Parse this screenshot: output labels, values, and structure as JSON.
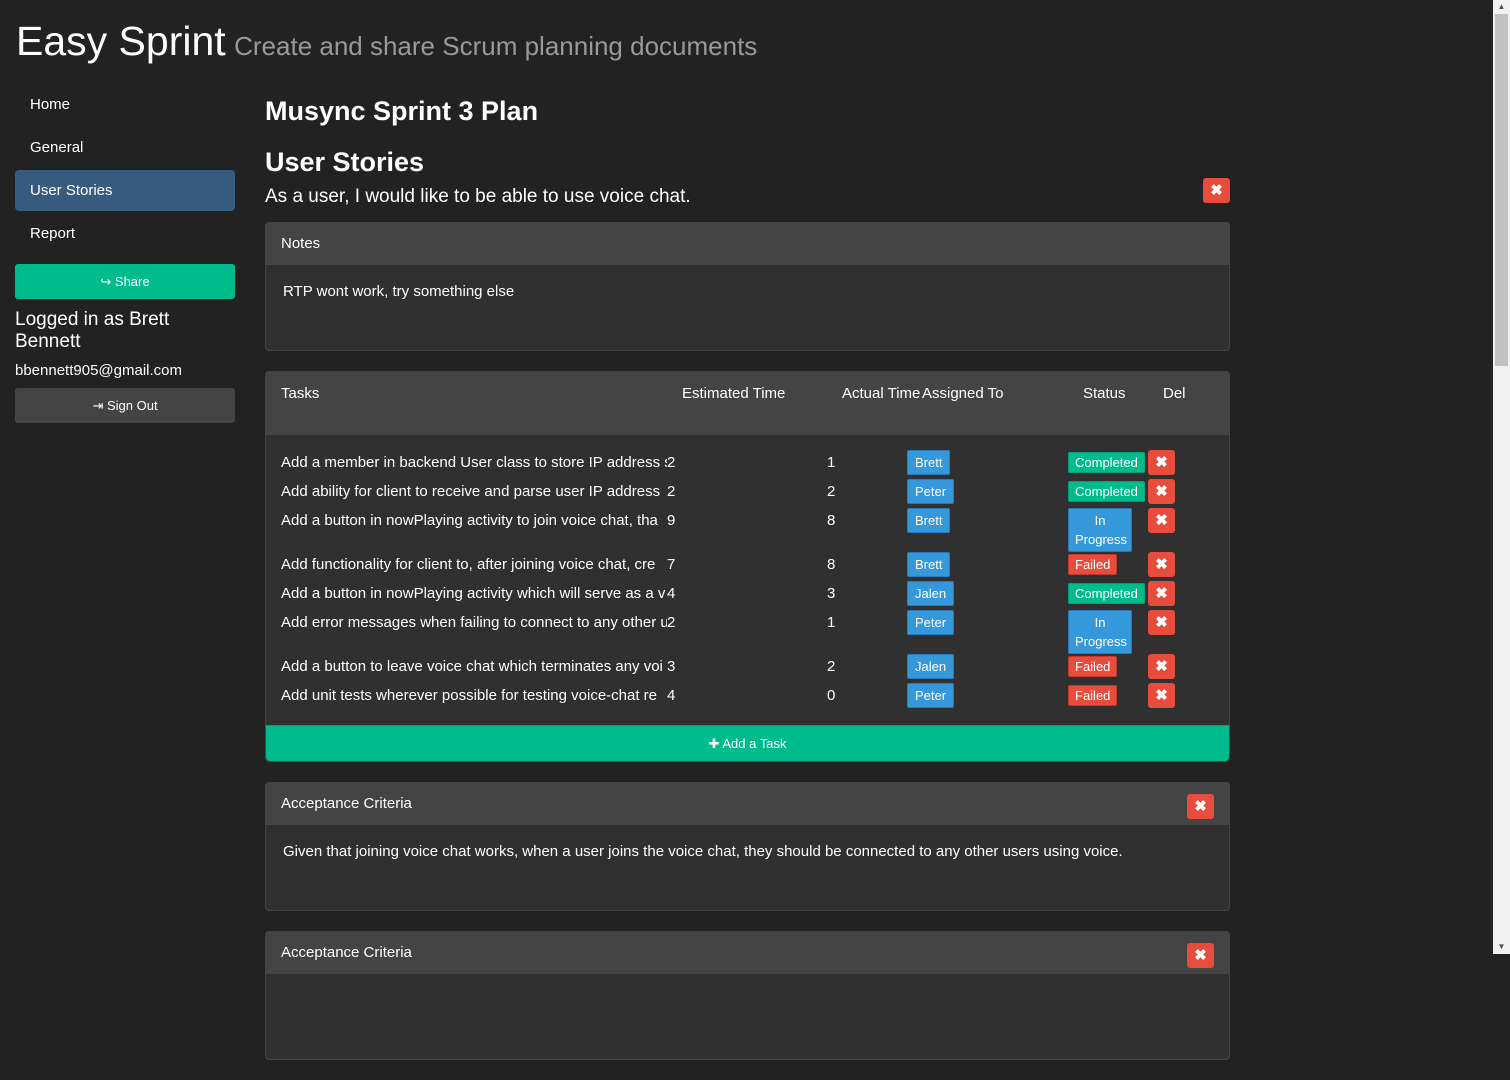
{
  "header": {
    "title": "Easy Sprint",
    "subtitle": "Create and share Scrum planning documents"
  },
  "sidebar": {
    "items": [
      {
        "label": "Home"
      },
      {
        "label": "General"
      },
      {
        "label": "User Stories"
      },
      {
        "label": "Report"
      }
    ],
    "active_item": "User Stories",
    "share_label": "Share",
    "logged_in_text": "Logged in as Brett Bennett",
    "email": "bbennett905@gmail.com",
    "signout_label": "Sign Out"
  },
  "main": {
    "page_title": "Musync Sprint 3 Plan",
    "section_title": "User Stories",
    "story": {
      "text": "As a user, I would like to be able to use voice chat.",
      "delete_label": "✖"
    },
    "notes": {
      "heading": "Notes",
      "body": "RTP wont work, try something else"
    },
    "tasks": {
      "headers": {
        "name": "Tasks",
        "estimated": "Estimated Time",
        "actual": "Actual Time",
        "assigned": "Assigned To",
        "status": "Status",
        "del": "Del"
      },
      "rows": [
        {
          "name": "Add a member in backend User class to store IP address s",
          "estimated": "2",
          "actual": "1",
          "assigned": "Brett",
          "status": "Completed"
        },
        {
          "name": "Add ability for client to receive and parse user IP address",
          "estimated": "2",
          "actual": "2",
          "assigned": "Peter",
          "status": "Completed"
        },
        {
          "name": "Add a button in nowPlaying activity to join voice chat, tha",
          "estimated": "9",
          "actual": "8",
          "assigned": "Brett",
          "status": "In Progress"
        },
        {
          "name": "Add functionality for client to, after joining voice chat, cre",
          "estimated": "7",
          "actual": "8",
          "assigned": "Brett",
          "status": "Failed"
        },
        {
          "name": "Add a button in nowPlaying activity which will serve as a v",
          "estimated": "4",
          "actual": "3",
          "assigned": "Jalen",
          "status": "Completed"
        },
        {
          "name": "Add error messages when failing to connect to any other u",
          "estimated": "2",
          "actual": "1",
          "assigned": "Peter",
          "status": "In Progress"
        },
        {
          "name": "Add a button to leave voice chat which terminates any voi",
          "estimated": "3",
          "actual": "2",
          "assigned": "Jalen",
          "status": "Failed"
        },
        {
          "name": "Add unit tests wherever possible for testing voice-chat re",
          "estimated": "4",
          "actual": "0",
          "assigned": "Peter",
          "status": "Failed"
        }
      ],
      "add_label": "Add a Task"
    },
    "acceptance": [
      {
        "heading": "Acceptance Criteria",
        "body": "Given that joining voice chat works, when a user joins the voice chat, they should be connected to any other users using voice."
      },
      {
        "heading": "Acceptance Criteria",
        "body": ""
      }
    ]
  },
  "colors": {
    "background": "#222222",
    "active_nav": "#375a7f",
    "success": "#00bc8c",
    "info": "#3498db",
    "danger": "#e74c3c",
    "panel_heading": "#444444"
  }
}
